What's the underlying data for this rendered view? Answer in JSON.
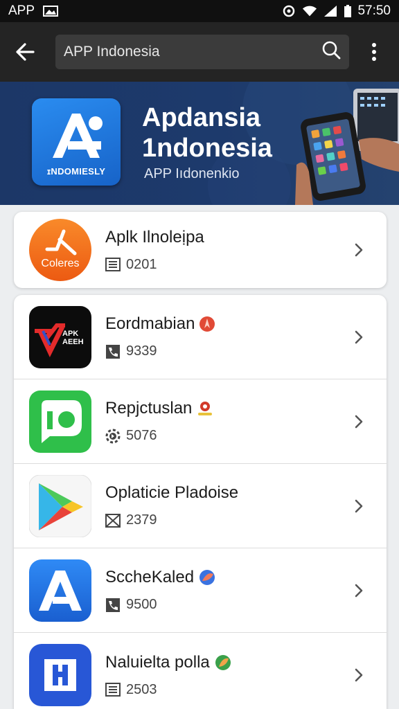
{
  "status_bar": {
    "app_label": "APP",
    "time": "57:50"
  },
  "toolbar": {
    "search_value": "APP Indonesia",
    "icons": [
      "back-arrow-icon",
      "search-icon",
      "more-vert-icon"
    ]
  },
  "banner": {
    "title": "Apdansia 1ndonesia",
    "subtitle": "APP Iıdonenkio",
    "logo_caption": "ɪNDOMIESLY"
  },
  "featured": {
    "title": "Aplk Ilnoleịpa",
    "meta_value": "0201",
    "icon_caption": "Coleres",
    "icon_name": "hockey-stick-icon",
    "meta_icon": "document-icon"
  },
  "apps": [
    {
      "title": "Eordmabian",
      "meta_value": "9339",
      "badge": "red-compass-badge",
      "meta_icon": "phone-icon",
      "icon_name": "apk-logo-icon",
      "icon_caption": "APK AEEH"
    },
    {
      "title": "Repjctuslan",
      "meta_value": "5076",
      "badge": "location-badge",
      "meta_icon": "gear-icon",
      "icon_name": "chat-bubble-icon"
    },
    {
      "title": "Oplaticie Pladoise",
      "meta_value": "2379",
      "badge": "",
      "meta_icon": "mail-icon",
      "icon_name": "play-store-icon"
    },
    {
      "title": "SccheKaled",
      "meta_value": "9500",
      "badge": "globe-badge",
      "meta_icon": "phone-icon",
      "icon_name": "a-logo-icon"
    },
    {
      "title": "Naluielta polla",
      "meta_value": "2503",
      "badge": "globe-badge",
      "meta_icon": "document-icon",
      "icon_name": "square-h-logo-icon"
    }
  ],
  "colors": {
    "toolbar": "#242424",
    "banner": "#1d3a6c",
    "accent_orange": "#f26a1b",
    "accent_green": "#2fbf4a",
    "accent_blue": "#1f6fe0"
  }
}
